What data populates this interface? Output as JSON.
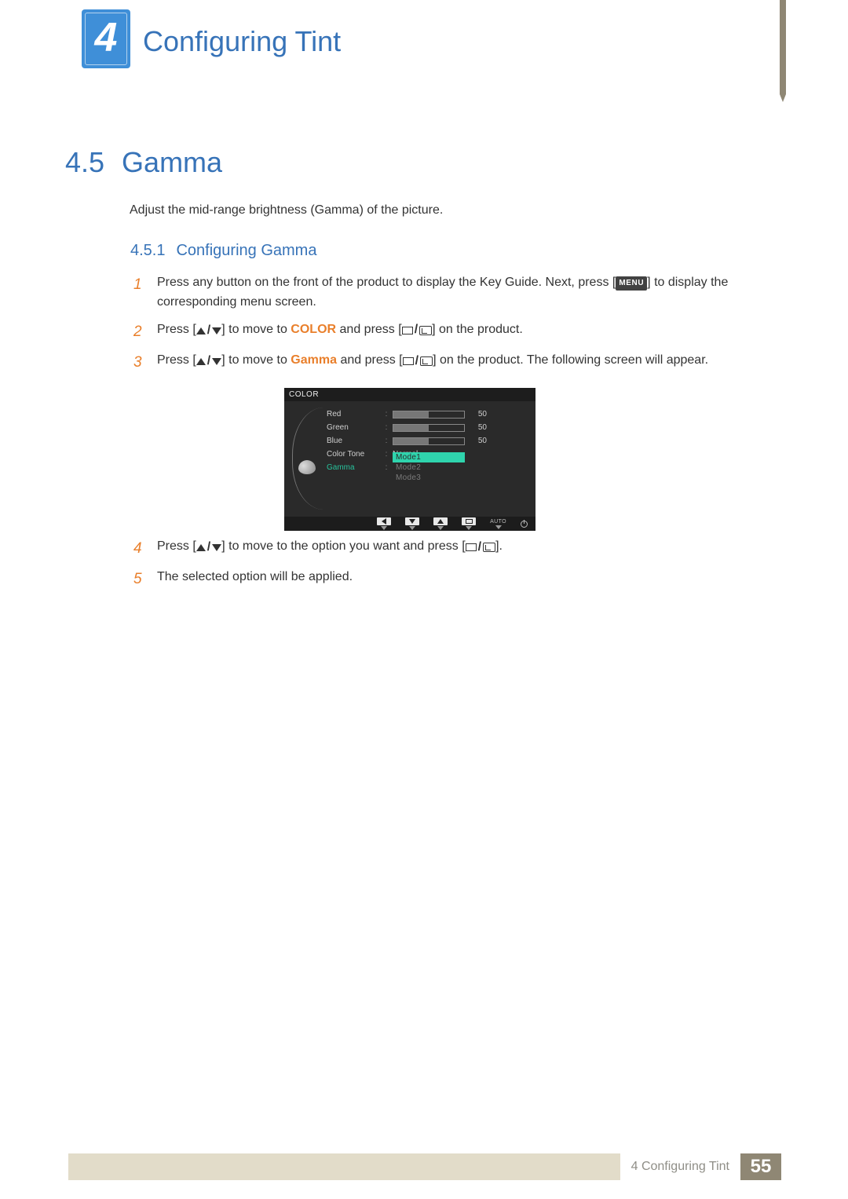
{
  "chapter": {
    "number": "4",
    "title": "Configuring Tint"
  },
  "section": {
    "number": "4.5",
    "title": "Gamma"
  },
  "intro": "Adjust the mid-range brightness (Gamma) of the picture.",
  "subsection": {
    "number": "4.5.1",
    "title": "Configuring Gamma"
  },
  "steps": {
    "s1": {
      "num": "1",
      "pre": "Press any button on the front of the product to display the Key Guide. Next, press [",
      "menu": "MENU",
      "post": "] to display the corresponding menu screen."
    },
    "s2": {
      "num": "2",
      "pre": "Press [",
      "mid": "] to move to ",
      "kw": "COLOR",
      "post": " and press [",
      "tail": "] on the product."
    },
    "s3": {
      "num": "3",
      "pre": "Press [",
      "mid": "] to move to ",
      "kw": "Gamma",
      "post": " and press [",
      "tail": "] on the product. The following screen will appear."
    },
    "s4": {
      "num": "4",
      "pre": "Press [",
      "mid": "] to move to the option you want and press [",
      "tail": "]."
    },
    "s5": {
      "num": "5",
      "text": "The selected option will be applied."
    }
  },
  "osd": {
    "title": "COLOR",
    "rows": {
      "red": {
        "label": "Red",
        "value": "50"
      },
      "green": {
        "label": "Green",
        "value": "50"
      },
      "blue": {
        "label": "Blue",
        "value": "50"
      },
      "tone": {
        "label": "Color Tone",
        "value": "Normal"
      },
      "gamma": {
        "label": "Gamma",
        "modes": {
          "m1": "Mode1",
          "m2": "Mode2",
          "m3": "Mode3"
        }
      }
    },
    "footer": {
      "auto": "AUTO"
    }
  },
  "footer": {
    "breadcrumb": "4 Configuring Tint",
    "page": "55"
  }
}
